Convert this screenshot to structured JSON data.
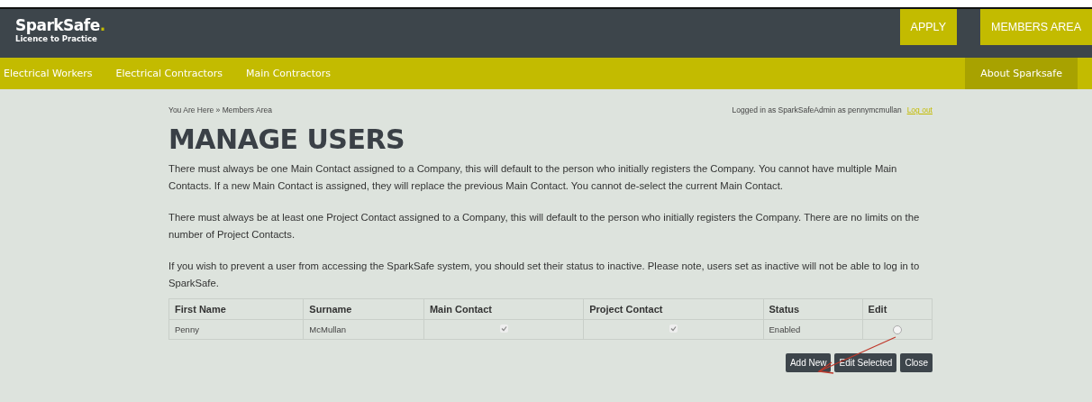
{
  "header": {
    "logo": "SparkSafe",
    "logo_dot": ".",
    "tagline": "Licence to Practice",
    "buttons": [
      {
        "label": "APPLY",
        "selected": false
      },
      {
        "label": "MEMBERS AREA",
        "selected": false
      }
    ]
  },
  "nav": {
    "items": [
      {
        "label": "Electrical Workers",
        "selected": false
      },
      {
        "label": "Electrical Contractors",
        "selected": false
      },
      {
        "label": "Main Contractors",
        "selected": false
      }
    ],
    "right_item": {
      "label": "About Sparksafe",
      "selected": true
    }
  },
  "breadcrumb": "You Are Here » Members Area",
  "login": {
    "text": "Logged in as SparkSafeAdmin as pennymcmullan",
    "link": "Log out"
  },
  "title": "MANAGE USERS",
  "paragraphs": [
    "There must always be one Main Contact assigned to a Company, this will default to the person who initially registers the Company. You cannot have multiple Main Contacts. If a new Main Contact is assigned, they will replace the previous Main Contact. You cannot de-select the current Main Contact.",
    "There must always be at least one Project Contact assigned to a Company, this will default to the person who initially registers the Company. There are no limits on the number of Project Contacts.",
    "If you wish to prevent a user from accessing the SparkSafe system, you should set their status to inactive. Please note, users set as inactive will not be able to log in to SparkSafe."
  ],
  "table": {
    "columns": [
      "First Name",
      "Surname",
      "Main Contact",
      "Project Contact",
      "Status",
      "Edit"
    ],
    "rows": [
      {
        "first_name": "Penny",
        "surname": "McMullan",
        "main_contact": true,
        "project_contact": true,
        "status": "Enabled",
        "selected": false
      }
    ]
  },
  "actions": [
    "Add New",
    "Edit Selected",
    "Close"
  ]
}
